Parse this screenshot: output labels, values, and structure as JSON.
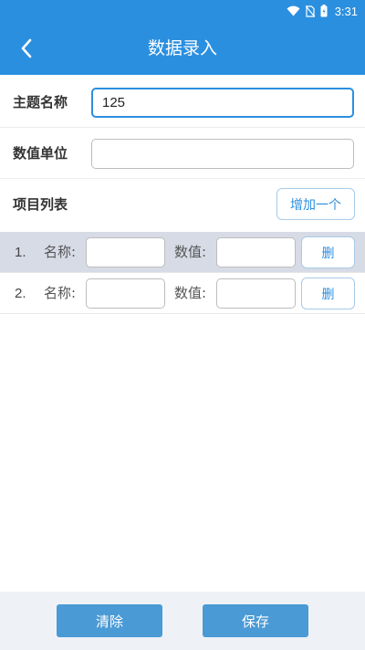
{
  "status_bar": {
    "time": "3:31",
    "icons": [
      "wifi-icon",
      "no-sim-icon",
      "battery-icon"
    ]
  },
  "app_bar": {
    "title": "数据录入",
    "back_icon": "chevron-left-icon"
  },
  "form": {
    "topic": {
      "label": "主题名称",
      "value": "125"
    },
    "unit": {
      "label": "数值单位",
      "value": ""
    },
    "item_list": {
      "label": "项目列表",
      "add_label": "增加一个"
    }
  },
  "items": [
    {
      "index": "1.",
      "name_label": "名称:",
      "value_label": "数值:",
      "delete_label": "删",
      "selected": true
    },
    {
      "index": "2.",
      "name_label": "名称:",
      "value_label": "数值:",
      "delete_label": "删",
      "selected": false
    }
  ],
  "footer": {
    "clear_label": "清除",
    "save_label": "保存"
  },
  "colors": {
    "primary": "#2b8fe0",
    "button": "#4a9ad6",
    "selected_row": "#d6dbe6",
    "footer_bg": "#eef2f6"
  }
}
